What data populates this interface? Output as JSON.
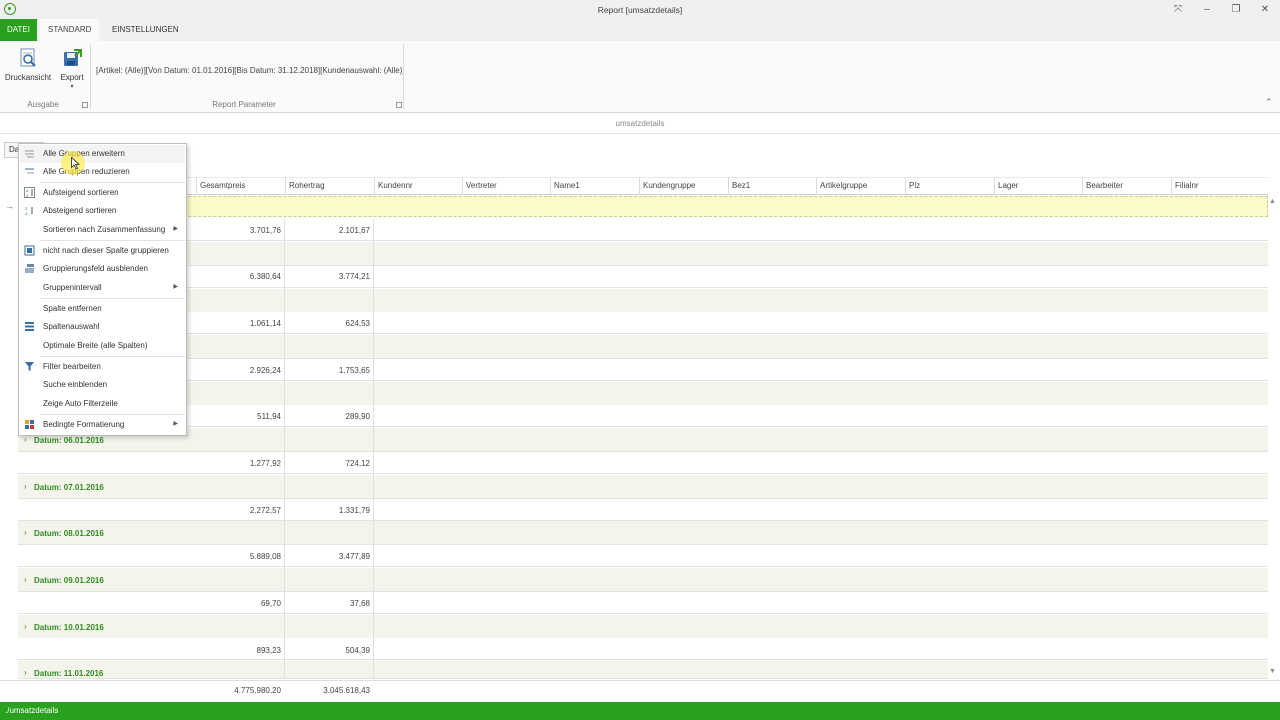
{
  "window": {
    "title": "Report [umsatzdetails]"
  },
  "tabs": [
    {
      "label": "DATEI"
    },
    {
      "label": "STANDARD"
    },
    {
      "label": "EINSTELLUNGEN"
    }
  ],
  "ribbon": {
    "print_preview_label": "Druckansicht",
    "export_label": "Export",
    "group_output_label": "Ausgabe",
    "group_params_label": "Report Parameter",
    "params_text": "[Artikel: (Alle)][Von Datum: 01.01.2016][Bis Datum: 31.12.2018][Kundenauswahl: (Alle)]"
  },
  "document": {
    "title": "umsatzdetails",
    "group_chip": "Da"
  },
  "grid": {
    "columns": [
      "Gesamtpreis",
      "Rohertrag",
      "Kundennr",
      "Vertreter",
      "Name1",
      "Kundengruppe",
      "Bez1",
      "Artikelgruppe",
      "Plz",
      "Lager",
      "Bearbeiter",
      "Filialnr"
    ],
    "rows": [
      {
        "gesamtpreis": "3.701,76",
        "rohertrag": "2.101,67"
      },
      {
        "gesamtpreis": "6.380,64",
        "rohertrag": "3.774,21"
      },
      {
        "gesamtpreis": "1.061,14",
        "rohertrag": "624,53"
      },
      {
        "gesamtpreis": "2.926,24",
        "rohertrag": "1.753,65"
      },
      {
        "gesamtpreis": "511,94",
        "rohertrag": "289,90"
      },
      {
        "group": "Datum: 06.01.2016",
        "gesamtpreis": "1.277,92",
        "rohertrag": "724,12"
      },
      {
        "group": "Datum: 07.01.2016",
        "gesamtpreis": "2.272,57",
        "rohertrag": "1.331,79"
      },
      {
        "group": "Datum: 08.01.2016",
        "gesamtpreis": "5.889,08",
        "rohertrag": "3.477,89"
      },
      {
        "group": "Datum: 09.01.2016",
        "gesamtpreis": "69,70",
        "rohertrag": "37,68"
      },
      {
        "group": "Datum: 10.01.2016",
        "gesamtpreis": "893,23",
        "rohertrag": "504,39"
      },
      {
        "group": "Datum: 11.01.2016"
      }
    ],
    "totals": {
      "gesamtpreis": "4.775.980,20",
      "rohertrag": "3.045.618,43"
    }
  },
  "context_menu": {
    "items": [
      {
        "label": "Alle Gruppen erweitern",
        "icon": "expand-groups-icon"
      },
      {
        "label": "Alle Gruppen reduzieren",
        "icon": "collapse-groups-icon"
      },
      {
        "label": "Aufsteigend sortieren",
        "icon": "sort-asc-icon"
      },
      {
        "label": "Absteigend sortieren",
        "icon": "sort-desc-icon"
      },
      {
        "label": "Sortieren nach Zusammenfassung",
        "submenu": true
      },
      {
        "label": "nicht nach dieser Spalte gruppieren",
        "icon": "ungroup-icon"
      },
      {
        "label": "Gruppierungsfeld ausblenden",
        "icon": "hide-group-panel-icon"
      },
      {
        "label": "Gruppenintervall",
        "submenu": true
      },
      {
        "label": "Spalte entfernen"
      },
      {
        "label": "Spaltenauswahl",
        "icon": "column-chooser-icon"
      },
      {
        "label": "Optimale Breite (alle Spalten)"
      },
      {
        "label": "Filter bearbeiten",
        "icon": "filter-icon"
      },
      {
        "label": "Suche einblenden"
      },
      {
        "label": "Zeige Auto Filterzeile"
      },
      {
        "label": "Bedingte Formatierung",
        "icon": "conditional-format-icon",
        "submenu": true
      }
    ]
  },
  "status": {
    "path": "./umsatzdetails"
  },
  "colors": {
    "accent": "#29a01e",
    "group_text": "#2f8e1f",
    "selected_row": "#fbfbc9"
  }
}
